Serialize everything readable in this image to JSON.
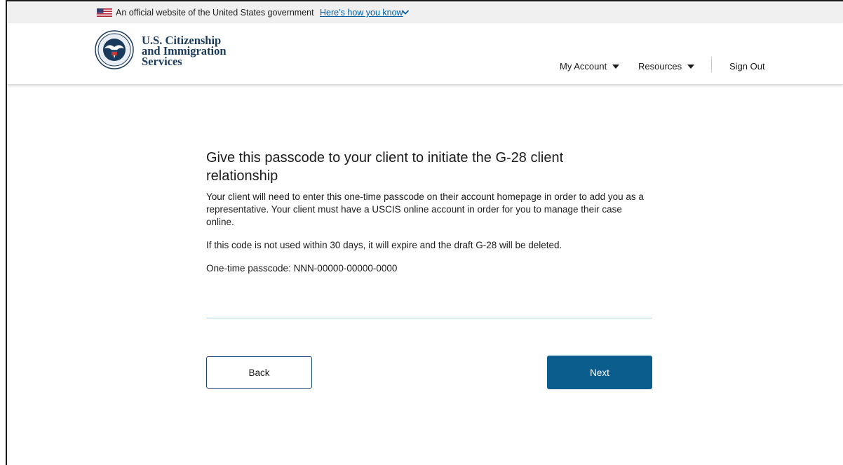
{
  "banner": {
    "official_text": "An official website of the United States government",
    "how_link": "Here’s how you know"
  },
  "header": {
    "agency_line1": "U.S. Citizenship",
    "agency_line2": "and Immigration",
    "agency_line3": "Services",
    "nav": {
      "my_account": "My Account",
      "resources": "Resources",
      "sign_out": "Sign Out"
    }
  },
  "main": {
    "title": "Give this passcode to your client to initiate the G-28 client relationship",
    "paragraph1": "Your client will need to enter this one-time passcode on their account homepage in order to add you as a representative. Your client must have a USCIS online account in order for you to manage their case online.",
    "paragraph2": "If this code is not used within 30 days, it will expire and the draft G-28 will be deleted.",
    "passcode_label": "One-time passcode: ",
    "passcode_value": "NNN-00000-00000-0000"
  },
  "buttons": {
    "back": "Back",
    "next": "Next"
  },
  "colors": {
    "primary": "#0b5d8e",
    "link": "#005ea2",
    "agency_text": "#1a3a5c",
    "divider": "#b5d9e8"
  },
  "icons": {
    "flag": "us-flag-icon",
    "chevron": "chevron-down-icon",
    "seal": "dhs-seal-icon",
    "caret": "caret-down-icon"
  }
}
